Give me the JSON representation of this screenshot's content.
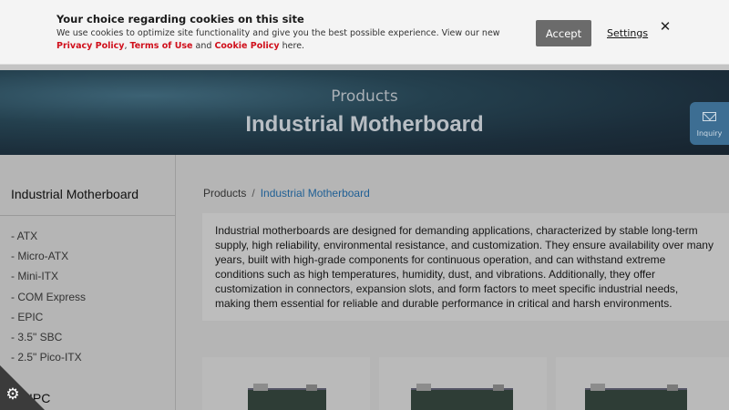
{
  "cookie": {
    "title": "Your choice regarding cookies on this site",
    "text_before": "We use cookies to optimize site functionality and give you the best possible experience. View our new ",
    "privacy_policy": "Privacy Policy",
    "comma": ", ",
    "terms_of_use": "Terms of Use",
    "and": " and ",
    "cookie_policy": "Cookie Policy",
    "text_after": " here.",
    "accept_label": "Accept",
    "settings_label": "Settings",
    "close_icon": "close-icon"
  },
  "hero": {
    "subtitle": "Products",
    "title": "Industrial Motherboard"
  },
  "inquiry": {
    "label": "Inquiry",
    "icon": "mail-icon"
  },
  "sidebar": {
    "title": "Industrial Motherboard",
    "items": [
      {
        "label": "- ATX"
      },
      {
        "label": "- Micro-ATX"
      },
      {
        "label": "- Mini-ITX"
      },
      {
        "label": "- COM Express"
      },
      {
        "label": "- EPIC"
      },
      {
        "label": "- 3.5\" SBC"
      },
      {
        "label": "- 2.5\" Pico-ITX"
      }
    ],
    "next_section": "IPC"
  },
  "breadcrumb": {
    "root": "Products",
    "separator": "/",
    "current": "Industrial Motherboard"
  },
  "description": "Industrial motherboards are designed for demanding applications, characterized by stable long-term supply, high reliability, environmental resistance, and customization. They ensure availability over many years, built with high-grade components for continuous operation, and can withstand extreme conditions such as high temperatures, humidity, dust, and vibrations. Additionally, they offer customization in connectors, expansion slots, and form factors to meet specific industrial needs, making them essential for reliable and durable performance in critical and harsh environments.",
  "colors": {
    "accent_red": "#d0101c",
    "link_blue": "#1f5f94",
    "inquiry_blue": "#3d6e93"
  }
}
